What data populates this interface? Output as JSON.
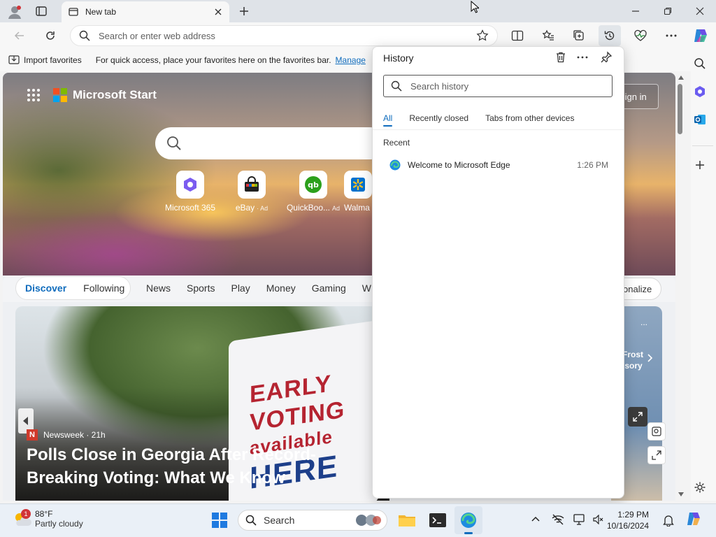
{
  "tab": {
    "title": "New tab"
  },
  "address": {
    "placeholder": "Search or enter web address"
  },
  "favorites_bar": {
    "import_label": "Import favorites",
    "message": "For quick access, place your favorites here on the favorites bar.",
    "manage_link": "Manage"
  },
  "hero": {
    "brand": "Microsoft Start",
    "signin": "Sign in",
    "quicklinks": [
      {
        "label": "Microsoft 365",
        "ad": ""
      },
      {
        "label": "eBay",
        "ad": "· Ad"
      },
      {
        "label": "QuickBoo...",
        "ad": "Ad"
      },
      {
        "label": "Walma",
        "ad": ""
      }
    ]
  },
  "nav": {
    "tabs": [
      "Discover",
      "Following",
      "News",
      "Sports",
      "Play",
      "Money",
      "Gaming",
      "W"
    ],
    "personalize": "onalize"
  },
  "card": {
    "source": "Newsweek · 21h",
    "source_badge": "N",
    "headline": "Polls Close in Georgia After Record-Breaking Voting: What We Know",
    "sign_lines": [
      "EARLY",
      "VOTING",
      "available",
      "HERE"
    ]
  },
  "right_card": {
    "line1": "Frost",
    "line2": "isory",
    "menu": "..."
  },
  "history": {
    "title": "History",
    "search_placeholder": "Search history",
    "tabs": [
      "All",
      "Recently closed",
      "Tabs from other devices"
    ],
    "section": "Recent",
    "items": [
      {
        "name": "Welcome to Microsoft Edge",
        "time": "1:26 PM"
      }
    ]
  },
  "taskbar": {
    "weather_temp": "88°F",
    "weather_desc": "Partly cloudy",
    "weather_badge": "1",
    "search_placeholder": "Search",
    "time": "1:29 PM",
    "date": "10/16/2024"
  },
  "colors": {
    "accent": "#0f6cbd",
    "edge_blue": "#1d8ce0",
    "news_red": "#d03a2b"
  }
}
